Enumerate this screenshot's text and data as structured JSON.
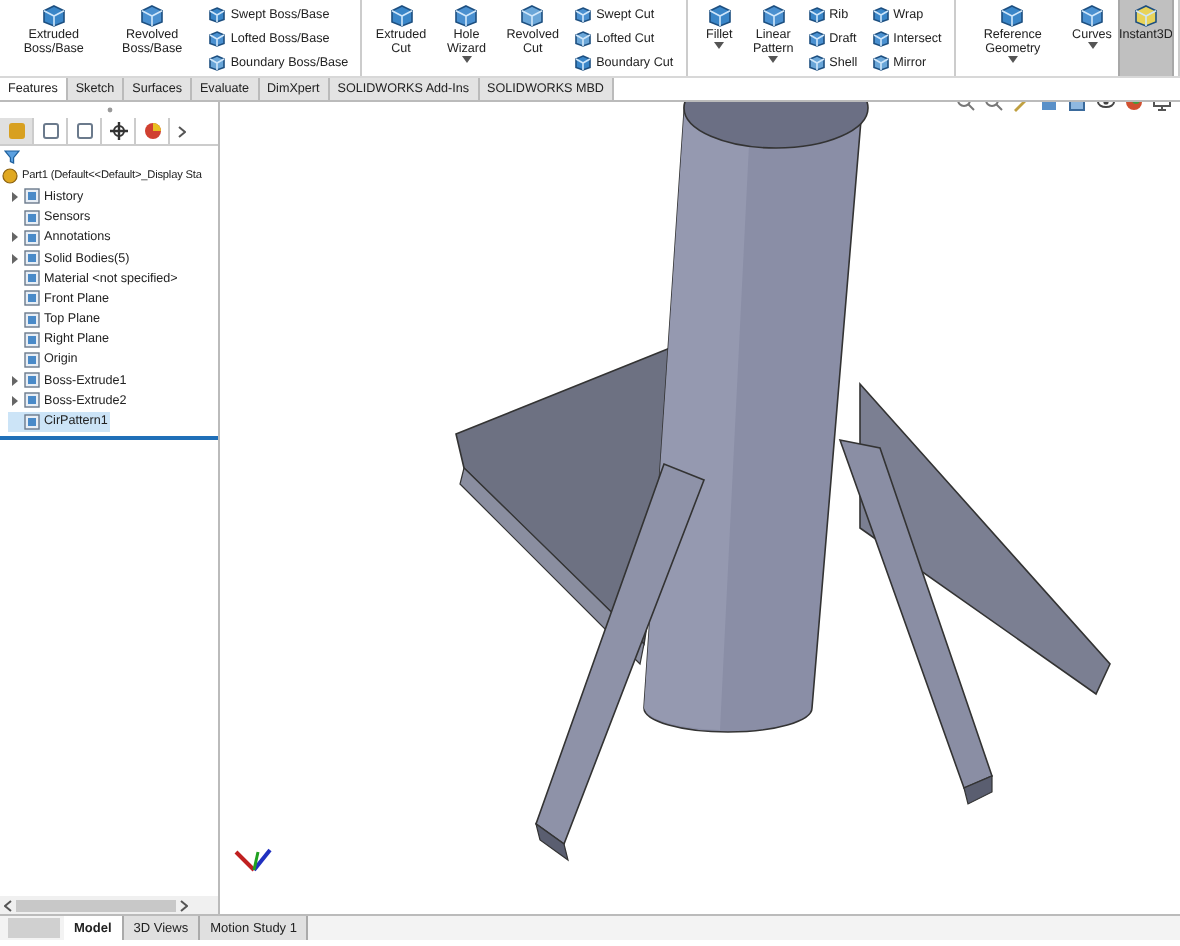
{
  "ribbon": {
    "groups": [
      {
        "buttons": [
          {
            "label": "Extruded Boss/Base",
            "kind": "large",
            "dropdown": false,
            "on": false
          },
          {
            "label": "Revolved Boss/Base",
            "kind": "large",
            "dropdown": false,
            "on": false
          },
          {
            "label": "Swept Boss/Base",
            "kind": "small"
          },
          {
            "label": "Lofted Boss/Base",
            "kind": "small"
          },
          {
            "label": "Boundary Boss/Base",
            "kind": "small"
          }
        ]
      },
      {
        "buttons": [
          {
            "label": "Extruded Cut",
            "kind": "large",
            "dropdown": false,
            "on": false
          },
          {
            "label": "Hole Wizard",
            "kind": "large",
            "dropdown": true,
            "on": false
          },
          {
            "label": "Revolved Cut",
            "kind": "large",
            "dropdown": false,
            "on": false
          },
          {
            "label": "Swept Cut",
            "kind": "small"
          },
          {
            "label": "Lofted Cut",
            "kind": "small"
          },
          {
            "label": "Boundary Cut",
            "kind": "small"
          }
        ]
      },
      {
        "buttons": [
          {
            "label": "Fillet",
            "kind": "large",
            "dropdown": true,
            "on": false
          },
          {
            "label": "Linear Pattern",
            "kind": "large",
            "dropdown": true,
            "on": false
          },
          {
            "label": "Rib",
            "kind": "small"
          },
          {
            "label": "Draft",
            "kind": "small"
          },
          {
            "label": "Shell",
            "kind": "small"
          },
          {
            "label": "Wrap",
            "kind": "small"
          },
          {
            "label": "Intersect",
            "kind": "small"
          },
          {
            "label": "Mirror",
            "kind": "small"
          }
        ]
      },
      {
        "buttons": [
          {
            "label": "Reference Geometry",
            "kind": "large",
            "dropdown": true,
            "on": false
          },
          {
            "label": "Curves",
            "kind": "large",
            "dropdown": true,
            "on": false
          },
          {
            "label": "Instant3D",
            "kind": "large",
            "dropdown": false,
            "on": true
          }
        ]
      }
    ]
  },
  "tabs": [
    {
      "label": "Features",
      "selected": true
    },
    {
      "label": "Sketch",
      "selected": false
    },
    {
      "label": "Surfaces",
      "selected": false
    },
    {
      "label": "Evaluate",
      "selected": false
    },
    {
      "label": "DimXpert",
      "selected": false
    },
    {
      "label": "SOLIDWORKS Add-Ins",
      "selected": false
    },
    {
      "label": "SOLIDWORKS MBD",
      "selected": false
    }
  ],
  "feature_tree": {
    "panel_tabs": [
      {
        "selected": true
      },
      {
        "selected": false
      },
      {
        "selected": false
      },
      {
        "selected": false
      },
      {
        "selected": false
      }
    ],
    "root": {
      "label": "Part1  (Default<<Default>_Display Sta",
      "children": [
        {
          "label": "History",
          "expandable": true,
          "selected": false
        },
        {
          "label": "Sensors",
          "expandable": false,
          "selected": false
        },
        {
          "label": "Annotations",
          "expandable": true,
          "selected": false
        },
        {
          "label": "Solid Bodies(5)",
          "expandable": true,
          "selected": false
        },
        {
          "label": "Material <not specified>",
          "expandable": false,
          "selected": false
        },
        {
          "label": "Front Plane",
          "expandable": false,
          "selected": false
        },
        {
          "label": "Top Plane",
          "expandable": false,
          "selected": false
        },
        {
          "label": "Right Plane",
          "expandable": false,
          "selected": false
        },
        {
          "label": "Origin",
          "expandable": false,
          "selected": false
        },
        {
          "label": "Boss-Extrude1",
          "expandable": true,
          "selected": false
        },
        {
          "label": "Boss-Extrude2",
          "expandable": true,
          "selected": false
        },
        {
          "label": "CirPattern1",
          "expandable": false,
          "selected": true
        }
      ]
    }
  },
  "bottom_tabs": [
    {
      "label": "Model",
      "selected": true
    },
    {
      "label": "3D Views",
      "selected": false
    },
    {
      "label": "Motion Study 1",
      "selected": false
    }
  ]
}
